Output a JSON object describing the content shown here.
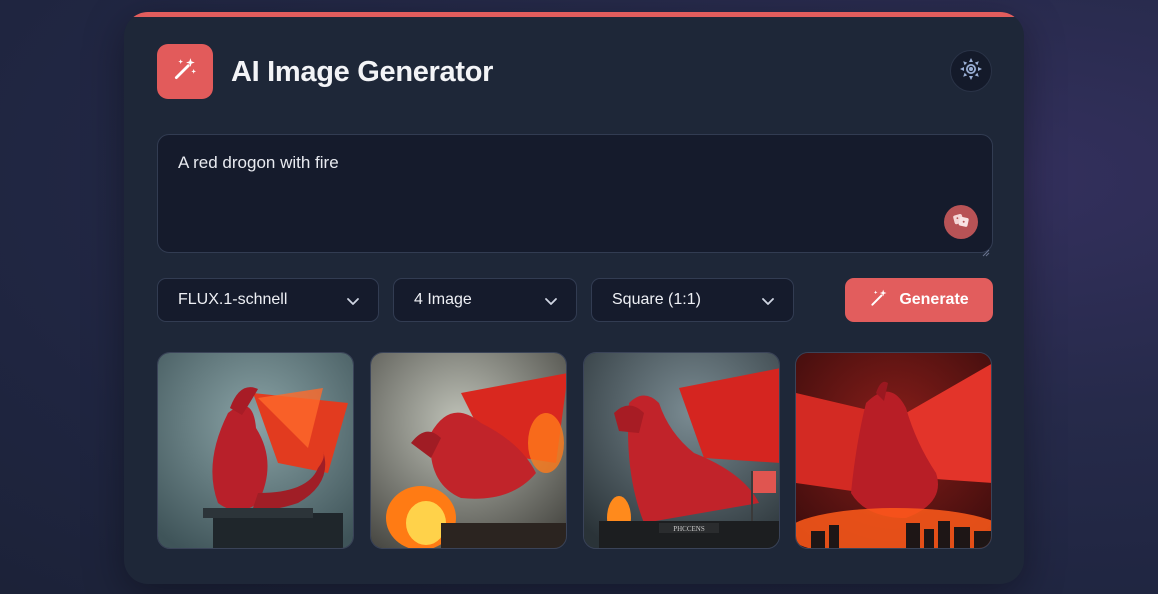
{
  "app": {
    "title": "AI Image Generator",
    "accent_color": "#e25d5d",
    "logo_icon": "magic-wand-icon",
    "theme_icon": "sun-icon"
  },
  "prompt": {
    "value": "A red drogon with fire",
    "random_icon": "dice-icon"
  },
  "controls": {
    "model": {
      "selected": "FLUX.1-schnell",
      "icon": "chevron-down-icon"
    },
    "count": {
      "selected": "4 Image",
      "icon": "chevron-down-icon"
    },
    "ratio": {
      "selected": "Square (1:1)",
      "icon": "chevron-down-icon"
    },
    "generate": {
      "label": "Generate",
      "icon": "magic-wand-icon"
    }
  },
  "gallery": {
    "images": [
      {
        "subject": "red dragon perched on ledge"
      },
      {
        "subject": "red dragon breathing fire"
      },
      {
        "subject": "red dragon on building",
        "sign_text": "PHCCENS"
      },
      {
        "subject": "red dragon over burning city"
      }
    ]
  }
}
